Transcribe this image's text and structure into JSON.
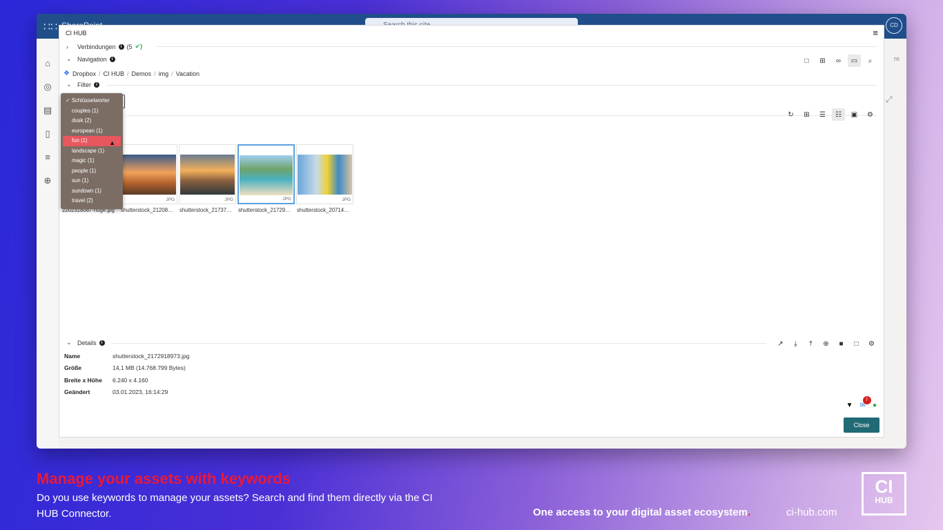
{
  "sharepoint": {
    "title": "SharePoint",
    "search_placeholder": "Search this site",
    "avatar": "CD",
    "ghost_right": "re"
  },
  "modal": {
    "title": "CI HUB",
    "connections": {
      "label": "Verbindungen",
      "count": "(5",
      "ok": "✔)"
    },
    "navigation": {
      "label": "Navigation"
    },
    "breadcrumb": [
      "Dropbox",
      "CI HUB",
      "Demos",
      "img",
      "Vacation"
    ],
    "filter": {
      "label": "Filter"
    },
    "keywords": [
      {
        "label": "✓ Schlüsselworter",
        "state": "checked"
      },
      {
        "label": "couples (1)"
      },
      {
        "label": "dusk (2)"
      },
      {
        "label": "european (1)"
      },
      {
        "label": "fun (1)",
        "state": "highlight"
      },
      {
        "label": "landscape (1)"
      },
      {
        "label": "magic (1)"
      },
      {
        "label": "people (1)"
      },
      {
        "label": "sun (1)"
      },
      {
        "label": "sundown (1)"
      },
      {
        "label": "travel (2)"
      }
    ],
    "thumbnails": [
      {
        "name": "2202318087-huge.jpg",
        "ext": "JPG"
      },
      {
        "name": "shutterstock_21208…",
        "ext": "JPG"
      },
      {
        "name": "shutterstock_21737…",
        "ext": "JPG"
      },
      {
        "name": "shutterstock_21729…",
        "ext": "JPG"
      },
      {
        "name": "shutterstock_20714…",
        "ext": "JPG"
      }
    ],
    "details": {
      "label": "Details",
      "rows": [
        {
          "key": "Name",
          "value": "shutterstock_2172918973.jpg"
        },
        {
          "key": "Größe",
          "value": "14,1 MB (14.768.799 Bytes)"
        },
        {
          "key": "Breite x Höhe",
          "value": "6.240 x 4.160"
        },
        {
          "key": "Geändert",
          "value": "03.01.2023, 16:14:29"
        }
      ]
    },
    "notification_count": "7",
    "close_label": "Close"
  },
  "promo": {
    "headline": "Manage your assets with keywords",
    "subline": "Do you use keywords to manage your assets? Search and find them directly via the CI HUB Connector.",
    "tagline": "One access to your digital asset ecosystem",
    "tagline_dot": ".",
    "site": "ci-hub.com",
    "logo_top": "CI",
    "logo_bottom": "HUB"
  },
  "colors": {
    "accent_red": "#e8193a",
    "close_button": "#1f6a74",
    "dropdown_bg": "#7b6d64",
    "dropdown_highlight": "#e8565e"
  }
}
